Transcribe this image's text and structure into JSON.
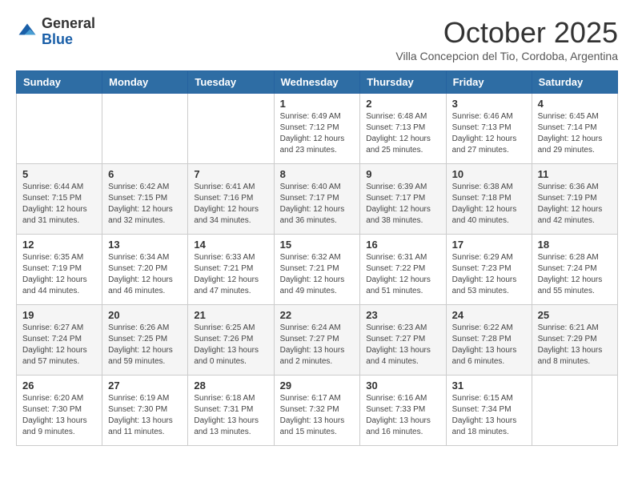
{
  "logo": {
    "general": "General",
    "blue": "Blue"
  },
  "title": "October 2025",
  "subtitle": "Villa Concepcion del Tio, Cordoba, Argentina",
  "days_of_week": [
    "Sunday",
    "Monday",
    "Tuesday",
    "Wednesday",
    "Thursday",
    "Friday",
    "Saturday"
  ],
  "weeks": [
    [
      {
        "day": "",
        "info": ""
      },
      {
        "day": "",
        "info": ""
      },
      {
        "day": "",
        "info": ""
      },
      {
        "day": "1",
        "info": "Sunrise: 6:49 AM\nSunset: 7:12 PM\nDaylight: 12 hours\nand 23 minutes."
      },
      {
        "day": "2",
        "info": "Sunrise: 6:48 AM\nSunset: 7:13 PM\nDaylight: 12 hours\nand 25 minutes."
      },
      {
        "day": "3",
        "info": "Sunrise: 6:46 AM\nSunset: 7:13 PM\nDaylight: 12 hours\nand 27 minutes."
      },
      {
        "day": "4",
        "info": "Sunrise: 6:45 AM\nSunset: 7:14 PM\nDaylight: 12 hours\nand 29 minutes."
      }
    ],
    [
      {
        "day": "5",
        "info": "Sunrise: 6:44 AM\nSunset: 7:15 PM\nDaylight: 12 hours\nand 31 minutes."
      },
      {
        "day": "6",
        "info": "Sunrise: 6:42 AM\nSunset: 7:15 PM\nDaylight: 12 hours\nand 32 minutes."
      },
      {
        "day": "7",
        "info": "Sunrise: 6:41 AM\nSunset: 7:16 PM\nDaylight: 12 hours\nand 34 minutes."
      },
      {
        "day": "8",
        "info": "Sunrise: 6:40 AM\nSunset: 7:17 PM\nDaylight: 12 hours\nand 36 minutes."
      },
      {
        "day": "9",
        "info": "Sunrise: 6:39 AM\nSunset: 7:17 PM\nDaylight: 12 hours\nand 38 minutes."
      },
      {
        "day": "10",
        "info": "Sunrise: 6:38 AM\nSunset: 7:18 PM\nDaylight: 12 hours\nand 40 minutes."
      },
      {
        "day": "11",
        "info": "Sunrise: 6:36 AM\nSunset: 7:19 PM\nDaylight: 12 hours\nand 42 minutes."
      }
    ],
    [
      {
        "day": "12",
        "info": "Sunrise: 6:35 AM\nSunset: 7:19 PM\nDaylight: 12 hours\nand 44 minutes."
      },
      {
        "day": "13",
        "info": "Sunrise: 6:34 AM\nSunset: 7:20 PM\nDaylight: 12 hours\nand 46 minutes."
      },
      {
        "day": "14",
        "info": "Sunrise: 6:33 AM\nSunset: 7:21 PM\nDaylight: 12 hours\nand 47 minutes."
      },
      {
        "day": "15",
        "info": "Sunrise: 6:32 AM\nSunset: 7:21 PM\nDaylight: 12 hours\nand 49 minutes."
      },
      {
        "day": "16",
        "info": "Sunrise: 6:31 AM\nSunset: 7:22 PM\nDaylight: 12 hours\nand 51 minutes."
      },
      {
        "day": "17",
        "info": "Sunrise: 6:29 AM\nSunset: 7:23 PM\nDaylight: 12 hours\nand 53 minutes."
      },
      {
        "day": "18",
        "info": "Sunrise: 6:28 AM\nSunset: 7:24 PM\nDaylight: 12 hours\nand 55 minutes."
      }
    ],
    [
      {
        "day": "19",
        "info": "Sunrise: 6:27 AM\nSunset: 7:24 PM\nDaylight: 12 hours\nand 57 minutes."
      },
      {
        "day": "20",
        "info": "Sunrise: 6:26 AM\nSunset: 7:25 PM\nDaylight: 12 hours\nand 59 minutes."
      },
      {
        "day": "21",
        "info": "Sunrise: 6:25 AM\nSunset: 7:26 PM\nDaylight: 13 hours\nand 0 minutes."
      },
      {
        "day": "22",
        "info": "Sunrise: 6:24 AM\nSunset: 7:27 PM\nDaylight: 13 hours\nand 2 minutes."
      },
      {
        "day": "23",
        "info": "Sunrise: 6:23 AM\nSunset: 7:27 PM\nDaylight: 13 hours\nand 4 minutes."
      },
      {
        "day": "24",
        "info": "Sunrise: 6:22 AM\nSunset: 7:28 PM\nDaylight: 13 hours\nand 6 minutes."
      },
      {
        "day": "25",
        "info": "Sunrise: 6:21 AM\nSunset: 7:29 PM\nDaylight: 13 hours\nand 8 minutes."
      }
    ],
    [
      {
        "day": "26",
        "info": "Sunrise: 6:20 AM\nSunset: 7:30 PM\nDaylight: 13 hours\nand 9 minutes."
      },
      {
        "day": "27",
        "info": "Sunrise: 6:19 AM\nSunset: 7:30 PM\nDaylight: 13 hours\nand 11 minutes."
      },
      {
        "day": "28",
        "info": "Sunrise: 6:18 AM\nSunset: 7:31 PM\nDaylight: 13 hours\nand 13 minutes."
      },
      {
        "day": "29",
        "info": "Sunrise: 6:17 AM\nSunset: 7:32 PM\nDaylight: 13 hours\nand 15 minutes."
      },
      {
        "day": "30",
        "info": "Sunrise: 6:16 AM\nSunset: 7:33 PM\nDaylight: 13 hours\nand 16 minutes."
      },
      {
        "day": "31",
        "info": "Sunrise: 6:15 AM\nSunset: 7:34 PM\nDaylight: 13 hours\nand 18 minutes."
      },
      {
        "day": "",
        "info": ""
      }
    ]
  ]
}
